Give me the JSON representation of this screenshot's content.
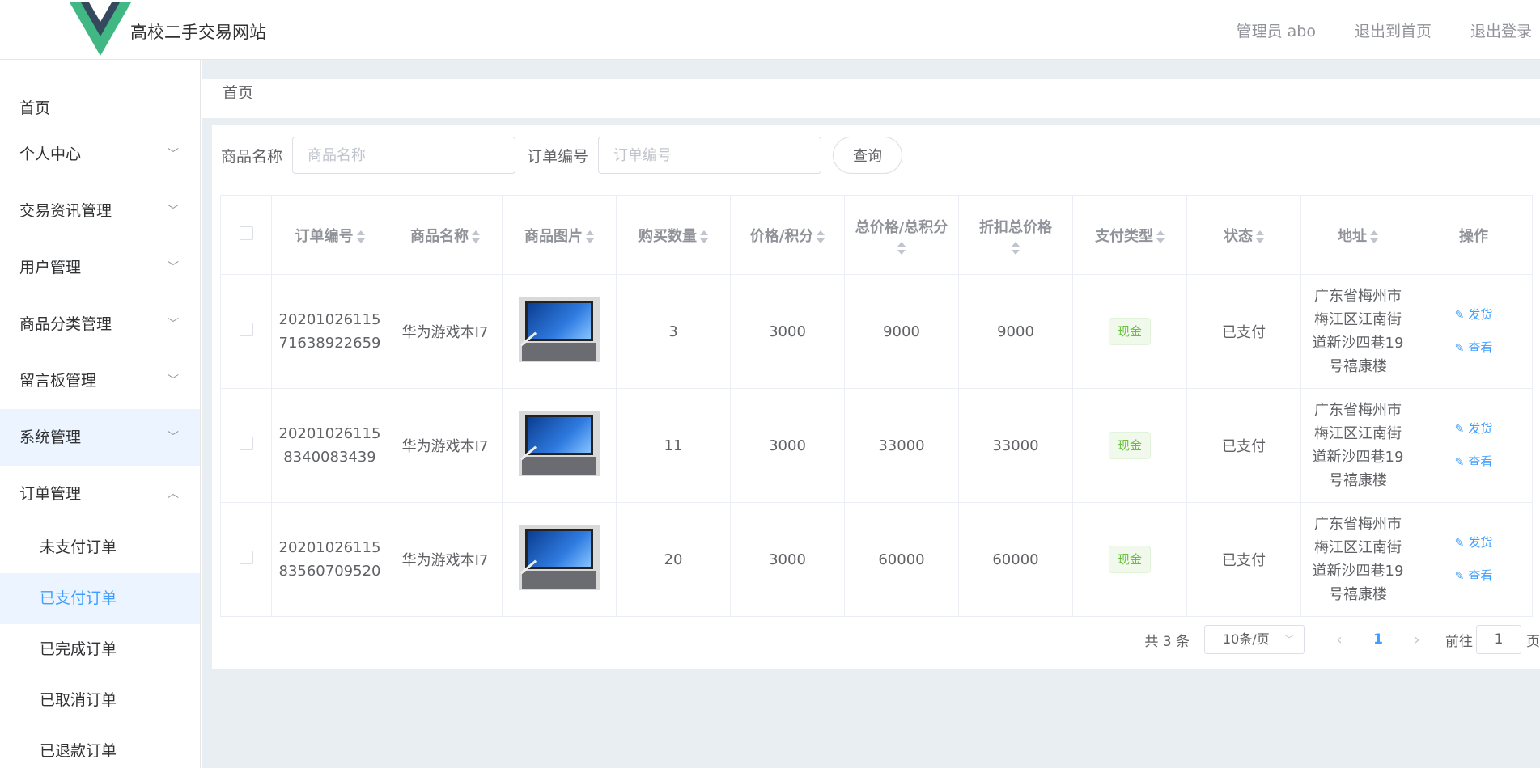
{
  "header": {
    "site_title": "高校二手交易网站",
    "links": [
      "管理员 abo",
      "退出到首页",
      "退出登录"
    ],
    "logo_colors": {
      "dark": "#35495e",
      "green": "#41b883"
    }
  },
  "sidebar": {
    "home": "首页",
    "groups": [
      {
        "label": "个人中心",
        "expanded": false
      },
      {
        "label": "交易资讯管理",
        "expanded": false
      },
      {
        "label": "用户管理",
        "expanded": false
      },
      {
        "label": "商品分类管理",
        "expanded": false
      },
      {
        "label": "留言板管理",
        "expanded": false
      },
      {
        "label": "系统管理",
        "expanded": false
      },
      {
        "label": "订单管理",
        "expanded": true
      }
    ],
    "sub_items": [
      "未支付订单",
      "已支付订单",
      "已完成订单",
      "已取消订单",
      "已退款订单"
    ],
    "active_sub": "已支付订单"
  },
  "breadcrumb": "首页",
  "search": {
    "product_label": "商品名称",
    "product_placeholder": "商品名称",
    "order_label": "订单编号",
    "order_placeholder": "订单编号",
    "button": "查询"
  },
  "table": {
    "headers": [
      "订单编号",
      "商品名称",
      "商品图片",
      "购买数量",
      "价格/积分",
      "总价格/总积分",
      "折扣总价格",
      "支付类型",
      "状态",
      "地址",
      "操作"
    ],
    "rows": [
      {
        "order_no_1": "20201026115",
        "order_no_2": "71638922659",
        "product": "华为游戏本I7",
        "qty": "3",
        "price": "3000",
        "total": "9000",
        "discount": "9000",
        "pay_type": "现金",
        "status": "已支付",
        "address": [
          "广东省梅州市",
          "梅江区江南街",
          "道新沙四巷19",
          "号禧康楼"
        ]
      },
      {
        "order_no_1": "20201026115",
        "order_no_2": "8340083439",
        "product": "华为游戏本I7",
        "qty": "11",
        "price": "3000",
        "total": "33000",
        "discount": "33000",
        "pay_type": "现金",
        "status": "已支付",
        "address": [
          "广东省梅州市",
          "梅江区江南街",
          "道新沙四巷19",
          "号禧康楼"
        ]
      },
      {
        "order_no_1": "20201026115",
        "order_no_2": "83560709520",
        "product": "华为游戏本I7",
        "qty": "20",
        "price": "3000",
        "total": "60000",
        "discount": "60000",
        "pay_type": "现金",
        "status": "已支付",
        "address": [
          "广东省梅州市",
          "梅江区江南街",
          "道新沙四巷19",
          "号禧康楼"
        ]
      }
    ],
    "actions": {
      "ship": "发货",
      "view": "查看"
    }
  },
  "pagination": {
    "total": "共 3 条",
    "page_size": "10条/页",
    "prev_icon": "‹",
    "current_page": "1",
    "next_icon": "›",
    "goto_label": "前往",
    "goto_value": "1",
    "page_suffix": "页"
  }
}
